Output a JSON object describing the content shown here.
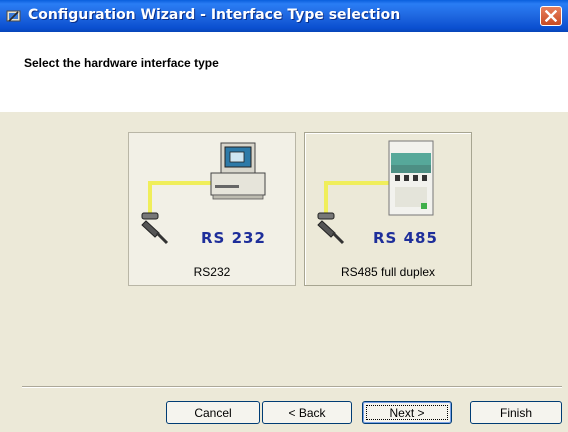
{
  "window": {
    "title": "Configuration Wizard - Interface Type selection"
  },
  "header": {
    "title": "Select the hardware interface type"
  },
  "options": [
    {
      "id": "rs232",
      "image_text": "RS 232",
      "label": "RS232",
      "selected": true
    },
    {
      "id": "rs485",
      "image_text": "RS 485",
      "label": "RS485 full duplex",
      "selected": false
    }
  ],
  "buttons": {
    "cancel": "Cancel",
    "back": "< Back",
    "next": "Next >",
    "finish": "Finish"
  },
  "icons": {
    "title_icon": "wizard-icon",
    "close": "close-icon",
    "rs232_device": "computer-icon",
    "rs485_device": "rs485-module-icon",
    "connector": "serial-connector-icon"
  },
  "colors": {
    "titlebar": "#0A4FD0",
    "close_button": "#D85C32",
    "cable": "#F0EE5A",
    "interface_text": "#1E2E9A",
    "dialog_face": "#ECE9D8"
  }
}
